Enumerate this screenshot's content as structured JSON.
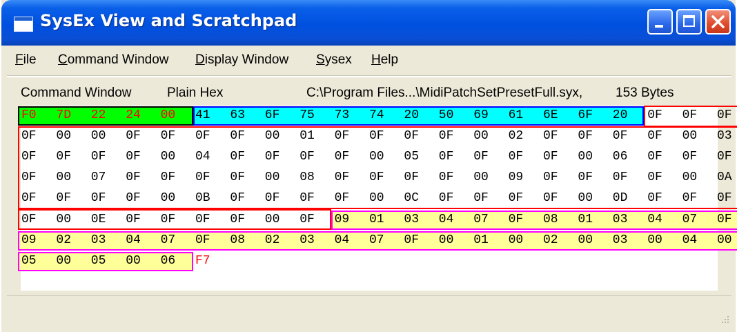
{
  "window": {
    "title": "SysEx View and Scratchpad"
  },
  "menu": [
    {
      "label": "File",
      "hot": "F",
      "rest": "ile"
    },
    {
      "label": "Command Window",
      "hot": "C",
      "rest": "ommand Window"
    },
    {
      "label": "Display Window",
      "hot": "D",
      "rest": "isplay Window"
    },
    {
      "label": "Sysex",
      "hot": "S",
      "rest": "ysex"
    },
    {
      "label": "Help",
      "hot": "H",
      "rest": "elp"
    }
  ],
  "info": {
    "mode": "Command Window",
    "format": "Plain Hex",
    "file": "C:\\Program Files...\\MidiPatchSetPresetFull.syx,",
    "size": "153 Bytes"
  },
  "hex_rows": [
    [
      "F0",
      "7D",
      "22",
      "24",
      "00",
      "41",
      "63",
      "6F",
      "75",
      "73",
      "74",
      "20",
      "50",
      "69",
      "61",
      "6E",
      "6F",
      "20",
      "0F",
      "0F",
      "0F"
    ],
    [
      "0F",
      "00",
      "00",
      "0F",
      "0F",
      "0F",
      "0F",
      "00",
      "01",
      "0F",
      "0F",
      "0F",
      "0F",
      "00",
      "02",
      "0F",
      "0F",
      "0F",
      "0F",
      "00",
      "03"
    ],
    [
      "0F",
      "0F",
      "0F",
      "0F",
      "00",
      "04",
      "0F",
      "0F",
      "0F",
      "0F",
      "00",
      "05",
      "0F",
      "0F",
      "0F",
      "0F",
      "00",
      "06",
      "0F",
      "0F",
      "0F"
    ],
    [
      "0F",
      "00",
      "07",
      "0F",
      "0F",
      "0F",
      "0F",
      "00",
      "08",
      "0F",
      "0F",
      "0F",
      "0F",
      "00",
      "09",
      "0F",
      "0F",
      "0F",
      "0F",
      "00",
      "0A"
    ],
    [
      "0F",
      "0F",
      "0F",
      "0F",
      "00",
      "0B",
      "0F",
      "0F",
      "0F",
      "0F",
      "00",
      "0C",
      "0F",
      "0F",
      "0F",
      "0F",
      "00",
      "0D",
      "0F",
      "0F",
      "0F"
    ],
    [
      "0F",
      "00",
      "0E",
      "0F",
      "0F",
      "0F",
      "0F",
      "00",
      "0F",
      "09",
      "01",
      "03",
      "04",
      "07",
      "0F",
      "08",
      "01",
      "03",
      "04",
      "07",
      "0F"
    ],
    [
      "09",
      "02",
      "03",
      "04",
      "07",
      "0F",
      "08",
      "02",
      "03",
      "04",
      "07",
      "0F",
      "00",
      "01",
      "00",
      "02",
      "00",
      "03",
      "00",
      "04",
      "00"
    ],
    [
      "05",
      "00",
      "05",
      "00",
      "06",
      "F7"
    ]
  ],
  "colors": {
    "header_fill": "#00ff00",
    "header_text": "#ff0000",
    "name_fill": "#00ffff",
    "name_border": "#0000ff",
    "params_border": "#ff0000",
    "table_fill": "#ffff99",
    "table_border": "#ff00ff",
    "eox_text": "#ff0000"
  }
}
